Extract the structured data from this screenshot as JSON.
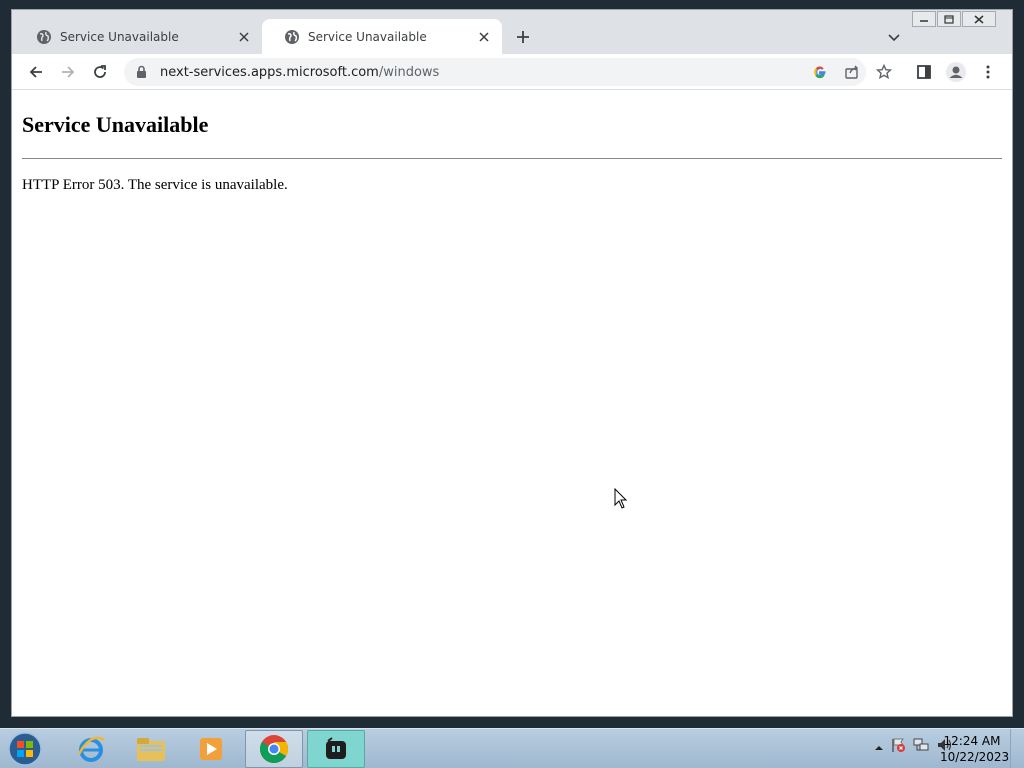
{
  "browser": {
    "tabs": [
      {
        "label": "Service Unavailable",
        "active": false
      },
      {
        "label": "Service Unavailable",
        "active": true
      }
    ],
    "url_host": "next-services.apps.microsoft.com",
    "url_path": "/windows"
  },
  "page": {
    "heading": "Service Unavailable",
    "message": "HTTP Error 503. The service is unavailable."
  },
  "taskbar": {
    "clock_time": "12:24 AM",
    "clock_date": "10/22/2023"
  },
  "colors": {
    "tabstrip": "#dee1e6",
    "omnibox": "#f1f3f4",
    "taskbar": "#b8cde0"
  }
}
